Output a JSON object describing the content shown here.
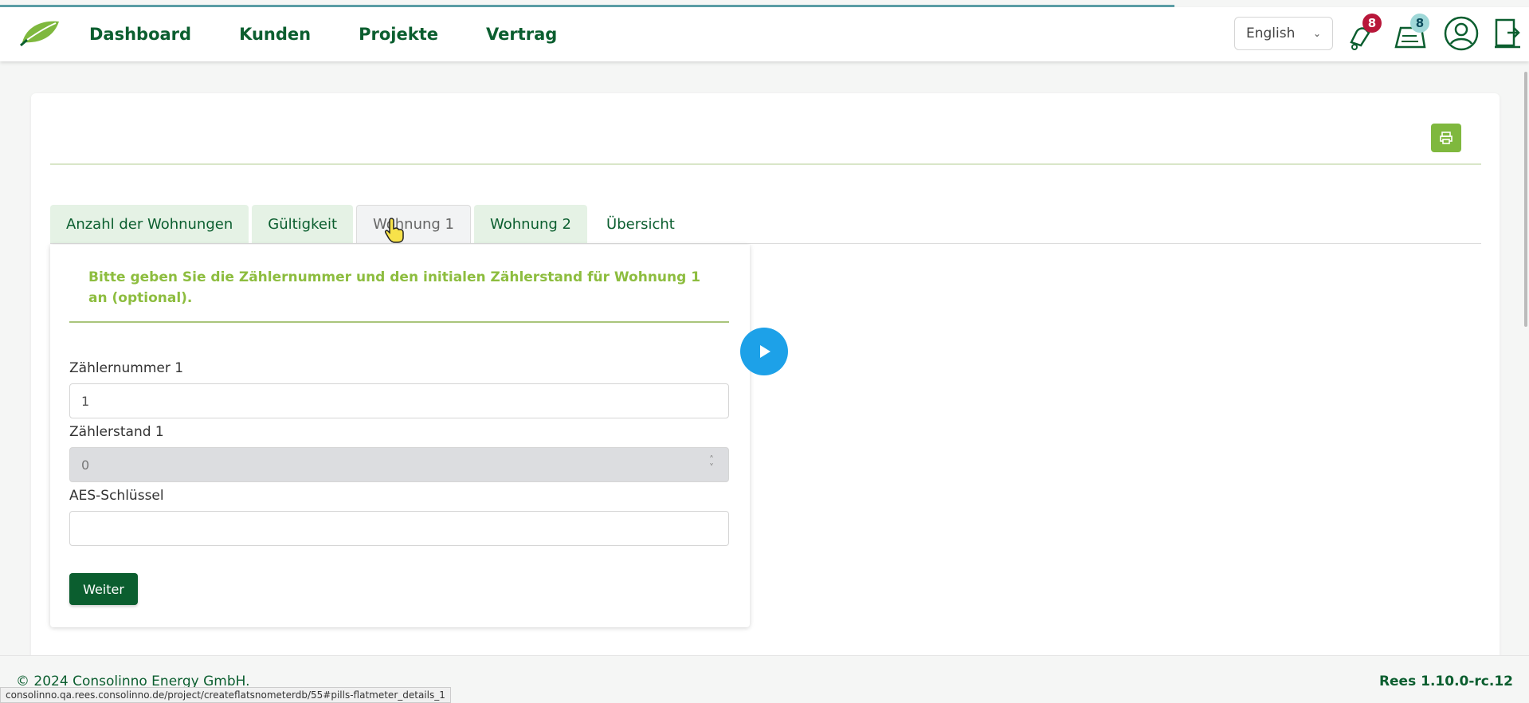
{
  "nav": {
    "items": [
      "Dashboard",
      "Kunden",
      "Projekte",
      "Vertrag"
    ]
  },
  "header": {
    "language": "English",
    "notifications_count": "8",
    "messages_count": "8"
  },
  "tabs": [
    {
      "label": "Anzahl der Wohnungen"
    },
    {
      "label": "Gültigkeit"
    },
    {
      "label": "Wohnung 1"
    },
    {
      "label": "Wohnung 2"
    },
    {
      "label": "Übersicht"
    }
  ],
  "form": {
    "heading": "Bitte geben Sie die Zählernummer und den initialen Zählerstand für Wohnung 1 an (optional).",
    "meter_number_label": "Zählernummer 1",
    "meter_number_value": "1",
    "meter_reading_label": "Zählerstand 1",
    "meter_reading_value": "0",
    "aes_key_label": "AES-Schlüssel",
    "aes_key_value": "",
    "submit_label": "Weiter"
  },
  "footer": {
    "copyright": "© 2024 Consolinno Energy GmbH.",
    "version": "Rees 1.10.0-rc.12"
  },
  "status_url": "consolinno.qa.rees.consolinno.de/project/createflatsnometerdb/55#pills-flatmeter_details_1",
  "colors": {
    "brand_green": "#0b5e2f",
    "accent_green": "#8dbd3f",
    "play_blue": "#1da1e8",
    "badge_red": "#b8173a"
  }
}
